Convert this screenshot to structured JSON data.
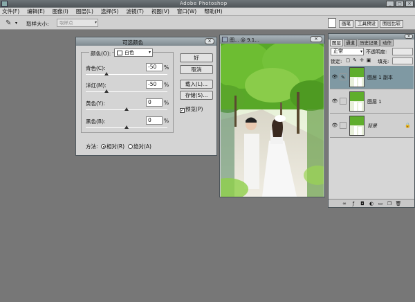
{
  "app": {
    "title": "Adobe Photoshop"
  },
  "window_controls": {
    "minimize": "_",
    "maximize": "□",
    "close": "×"
  },
  "menu": [
    "文件(F)",
    "编辑(E)",
    "图像(I)",
    "图层(L)",
    "选择(S)",
    "滤镜(T)",
    "视图(V)",
    "窗口(W)",
    "帮助(H)"
  ],
  "options_bar": {
    "sample_label": "取样大小:",
    "sample_value": "取样点"
  },
  "palette_tabs": [
    "画笔",
    "工具预设",
    "图层比较"
  ],
  "dialog": {
    "title": "可选颜色",
    "colors_label": "颜色(O):",
    "color_value": "白色",
    "sliders": [
      {
        "label": "青色(C):",
        "value": "-50",
        "unit": "%",
        "level": -50
      },
      {
        "label": "洋红(M):",
        "value": "-50",
        "unit": "%",
        "level": -50
      },
      {
        "label": "黄色(Y):",
        "value": "0",
        "unit": "%",
        "level": 0
      },
      {
        "label": "黑色(B):",
        "value": "0",
        "unit": "%",
        "level": 0
      }
    ],
    "buttons": {
      "ok": "好",
      "cancel": "取消",
      "load": "载入(L)...",
      "save": "存储(S)..."
    },
    "preview_label": "预览(P)",
    "method_label": "方法:",
    "method_relative": "相对(R)",
    "method_absolute": "绝对(A)",
    "close": "×"
  },
  "image_window": {
    "title": "图... @ 9.1...",
    "close": "×"
  },
  "layers": {
    "tabs": [
      "图层",
      "通道",
      "历史记录",
      "动作"
    ],
    "blend_mode": "正常",
    "opacity_label": "不透明度:",
    "lock_label": "锁定:",
    "fill_label": "填充:",
    "items": [
      {
        "name": "图层 1 副本",
        "selected": true,
        "italic": false
      },
      {
        "name": "图层 1",
        "selected": false,
        "italic": false
      },
      {
        "name": "背景",
        "selected": false,
        "italic": true
      }
    ],
    "close": "×"
  }
}
